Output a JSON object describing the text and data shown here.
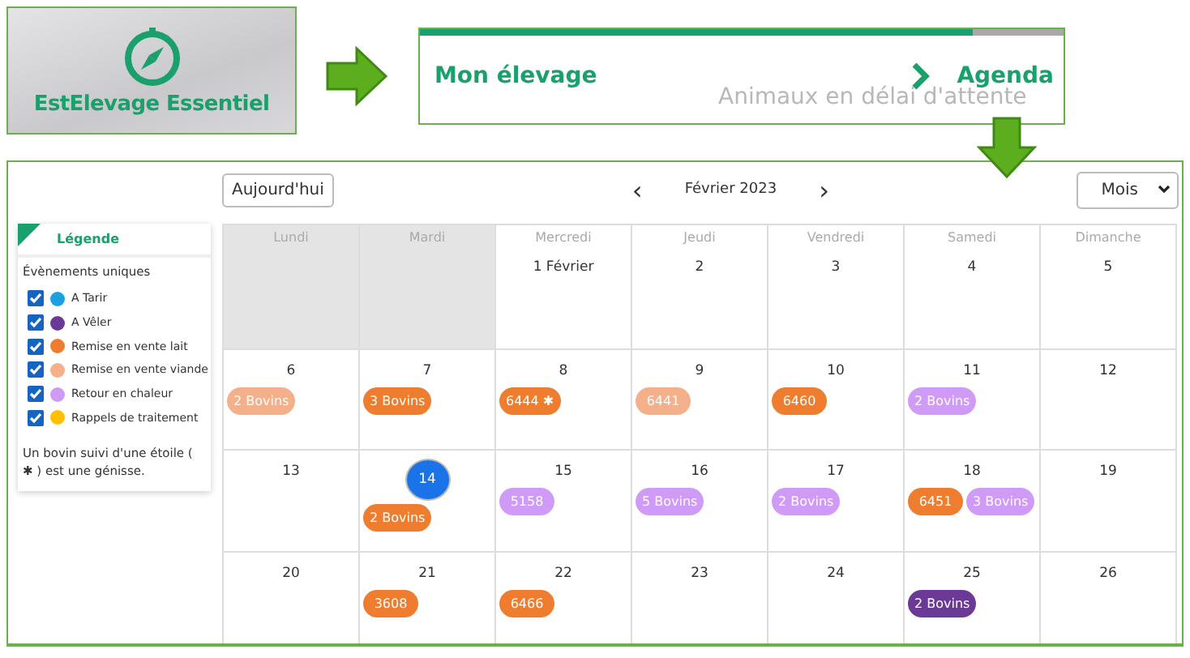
{
  "app_tile": {
    "title": "EstElevage Essentiel"
  },
  "breadcrumb": {
    "items": [
      "Mon élevage",
      "Agenda"
    ],
    "faded_text": "Animaux en délai d'attente",
    "level": 0.86
  },
  "toolbar": {
    "today_button": "Aujourd'hui",
    "prev": "‹",
    "month": "Février 2023",
    "next": "›",
    "view_select": "Mois"
  },
  "legend": {
    "title": "Légende",
    "subtitle": "Évènements uniques",
    "items": [
      {
        "label": "A Tarir",
        "checked": true,
        "color": "#1ba1e2"
      },
      {
        "label": "A Vêler",
        "checked": true,
        "color": "#6b3a96"
      },
      {
        "label": "Remise en vente lait",
        "checked": true,
        "color": "#ef7d2f"
      },
      {
        "label": "Remise en vente viande",
        "checked": true,
        "color": "#f4b08a"
      },
      {
        "label": "Retour en chaleur",
        "checked": true,
        "color": "#cf9bf7"
      },
      {
        "label": "Rappels de traitement",
        "checked": true,
        "color": "#ffc000"
      }
    ],
    "note": "Un bovin suivi d'une étoile ( ✱ ) est une génisse."
  },
  "calendar": {
    "day_names": [
      "Lundi",
      "Mardi",
      "Mercredi",
      "Jeudi",
      "Vendredi",
      "Samedi",
      "Dimanche"
    ],
    "weeks": [
      [
        {
          "outside": true
        },
        {
          "outside": true
        },
        {
          "label": "1 Février"
        },
        {
          "label": "2"
        },
        {
          "label": "3"
        },
        {
          "label": "4"
        },
        {
          "label": "5"
        }
      ],
      [
        {
          "label": "6",
          "events": [
            {
              "text": "2 Bovins",
              "color": "#f4b08a"
            }
          ]
        },
        {
          "label": "7",
          "events": [
            {
              "text": "3 Bovins",
              "color": "#ef7d2f"
            }
          ]
        },
        {
          "label": "8",
          "events": [
            {
              "text": "6444 ✱",
              "color": "#ef7d2f"
            }
          ]
        },
        {
          "label": "9",
          "events": [
            {
              "text": "6441",
              "color": "#f4b08a"
            }
          ]
        },
        {
          "label": "10",
          "events": [
            {
              "text": "6460",
              "color": "#ef7d2f"
            }
          ]
        },
        {
          "label": "11",
          "events": [
            {
              "text": "2 Bovins",
              "color": "#cf9bf7"
            }
          ]
        },
        {
          "label": "12"
        }
      ],
      [
        {
          "label": "13"
        },
        {
          "label": "14",
          "today": true,
          "events": [
            {
              "text": "2 Bovins",
              "color": "#ef7d2f"
            }
          ]
        },
        {
          "label": "15",
          "events": [
            {
              "text": "5158",
              "color": "#cf9bf7"
            }
          ]
        },
        {
          "label": "16",
          "events": [
            {
              "text": "5 Bovins",
              "color": "#cf9bf7"
            }
          ]
        },
        {
          "label": "17",
          "events": [
            {
              "text": "2 Bovins",
              "color": "#cf9bf7"
            }
          ]
        },
        {
          "label": "18",
          "events": [
            {
              "text": "6451",
              "color": "#ef7d2f"
            },
            {
              "text": "3 Bovins",
              "color": "#cf9bf7"
            }
          ]
        },
        {
          "label": "19"
        }
      ],
      [
        {
          "label": "20"
        },
        {
          "label": "21",
          "events": [
            {
              "text": "3608",
              "color": "#ef7d2f"
            }
          ]
        },
        {
          "label": "22",
          "events": [
            {
              "text": "6466",
              "color": "#ef7d2f"
            }
          ]
        },
        {
          "label": "23"
        },
        {
          "label": "24"
        },
        {
          "label": "25",
          "events": [
            {
              "text": "2 Bovins",
              "color": "#6b3a96"
            }
          ]
        },
        {
          "label": "26"
        }
      ]
    ]
  }
}
